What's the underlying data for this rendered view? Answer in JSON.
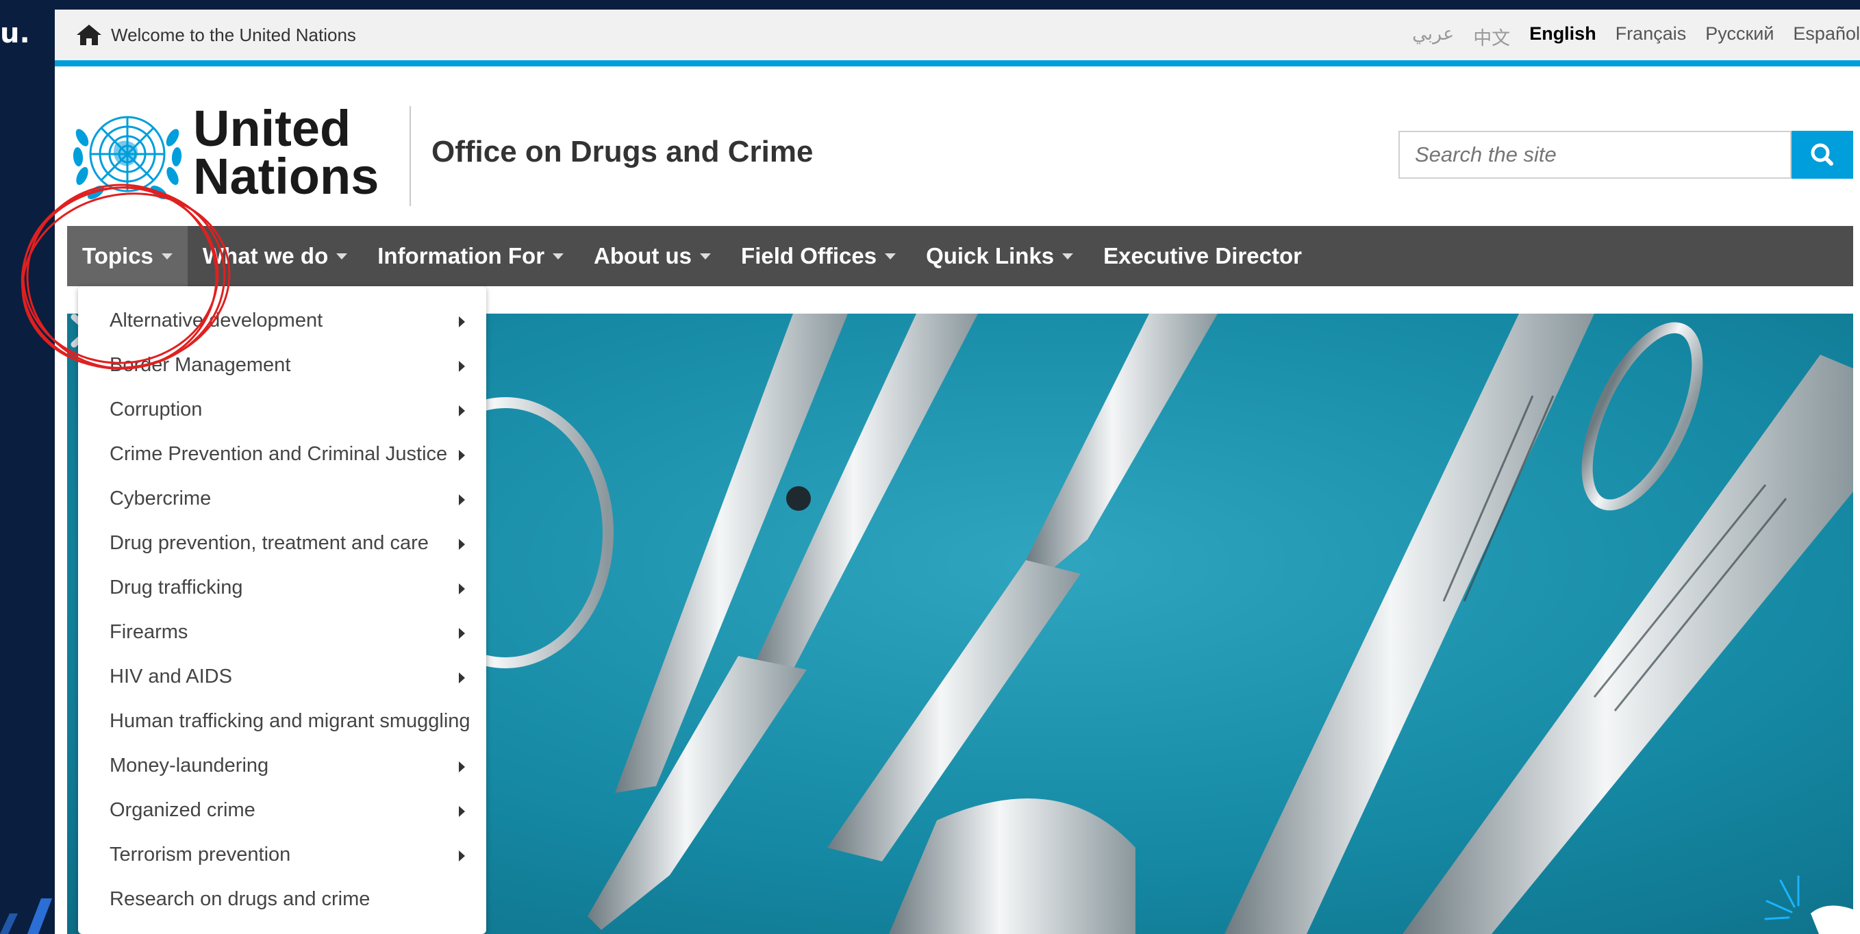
{
  "frame": {
    "edge_text": "u."
  },
  "topbar": {
    "welcome": "Welcome to the United Nations",
    "home_icon": "home-icon",
    "languages": [
      {
        "label": "عربي",
        "state": "muted"
      },
      {
        "label": "中文",
        "state": "muted"
      },
      {
        "label": "English",
        "state": "active"
      },
      {
        "label": "Français",
        "state": "normal"
      },
      {
        "label": "Русский",
        "state": "normal"
      },
      {
        "label": "Español",
        "state": "normal"
      }
    ]
  },
  "header": {
    "org_line1": "United",
    "org_line2": "Nations",
    "office": "Office on Drugs and Crime",
    "search_placeholder": "Search the site",
    "search_icon": "search-icon"
  },
  "nav": [
    {
      "label": "Topics",
      "has_caret": true,
      "active": true
    },
    {
      "label": "What we do",
      "has_caret": true
    },
    {
      "label": "Information For",
      "has_caret": true
    },
    {
      "label": "About us",
      "has_caret": true
    },
    {
      "label": "Field Offices",
      "has_caret": true
    },
    {
      "label": "Quick Links",
      "has_caret": true
    },
    {
      "label": "Executive Director",
      "has_caret": false
    }
  ],
  "topics_menu": [
    {
      "label": "Alternative development",
      "has_submenu": true
    },
    {
      "label": "Border Management",
      "has_submenu": true
    },
    {
      "label": "Corruption",
      "has_submenu": true
    },
    {
      "label": "Crime Prevention and Criminal Justice",
      "has_submenu": true
    },
    {
      "label": "Cybercrime",
      "has_submenu": true
    },
    {
      "label": "Drug prevention, treatment and care",
      "has_submenu": true
    },
    {
      "label": "Drug trafficking",
      "has_submenu": true
    },
    {
      "label": "Firearms",
      "has_submenu": true
    },
    {
      "label": "HIV and AIDS",
      "has_submenu": true
    },
    {
      "label": "Human trafficking and migrant smuggling",
      "has_submenu": false
    },
    {
      "label": "Money-laundering",
      "has_submenu": true
    },
    {
      "label": "Organized crime",
      "has_submenu": true
    },
    {
      "label": "Terrorism prevention",
      "has_submenu": true
    },
    {
      "label": "Research on drugs and crime",
      "has_submenu": false
    }
  ],
  "colors": {
    "un_blue": "#009edb",
    "nav_bg": "#4d4d4d",
    "annotation_red": "#e02020",
    "frame_bg": "#0a1f3f"
  }
}
